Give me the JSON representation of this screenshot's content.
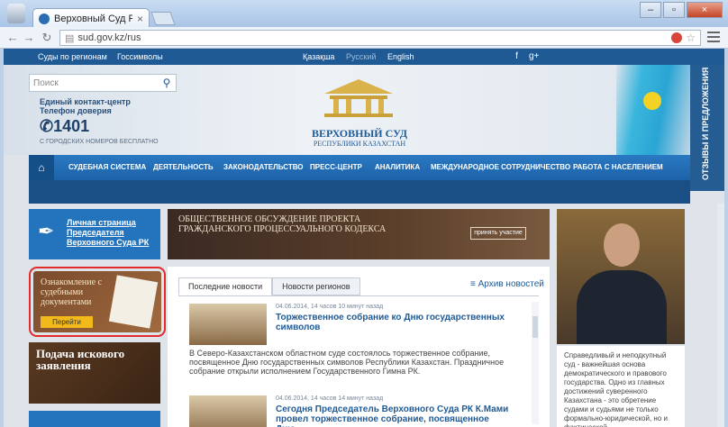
{
  "browser": {
    "tab_title": "Верховный Суд Республ",
    "tab_close": "×",
    "url": "sud.gov.kz/rus",
    "window_buttons": {
      "minimize": "–",
      "maximize": "▫",
      "close": "×"
    }
  },
  "topnav": {
    "regions": "Суды по регионам",
    "symbols": "Госсимволы",
    "lang_kz": "Қазақша",
    "lang_ru": "Русский",
    "lang_en": "English",
    "social": [
      "",
      "",
      "",
      "",
      "f",
      "g+",
      "",
      "",
      "",
      "",
      "",
      "",
      "",
      ""
    ]
  },
  "header": {
    "search_placeholder": "Поиск",
    "contact_line1": "Единый контакт-центр",
    "contact_line2": "Телефон доверия",
    "phone": "1401",
    "phone_note": "С ГОРОДСКИХ НОМЕРОВ БЕСПЛАТНО",
    "court_name_line1": "ВЕРХОВНЫЙ СУД",
    "court_name_line2": "РЕСПУБЛИКИ КАЗАХСТАН",
    "side_tab": "ОТЗЫВЫ И ПРЕДЛОЖЕНИЯ"
  },
  "mainnav": {
    "items": [
      "СУДЕБНАЯ СИСТЕМА",
      "ДЕЯТЕЛЬНОСТЬ",
      "ЗАКОНОДАТЕЛЬСТВО",
      "ПРЕСС-ЦЕНТР",
      "АНАЛИТИКА",
      "МЕЖДУНАРОДНОЕ СОТРУДНИЧЕСТВО",
      "РАБОТА С НАСЕЛЕНИЕМ"
    ]
  },
  "left": {
    "president_link": "Личная страница Председателя Верховного Суда РК",
    "docs_title": "Ознакомление с судебными документами",
    "docs_button": "Перейти",
    "claim_title": "Подача искового заявления"
  },
  "center": {
    "discussion_title": "ОБЩЕСТВЕННОЕ ОБСУЖДЕНИЕ ПРОЕКТА ГРАЖДАНСКОГО ПРОЦЕССУАЛЬНОГО КОДЕКСА",
    "discussion_button": "принять участие",
    "tab_latest": "Последние новости",
    "tab_regions": "Новости регионов",
    "archive": "Архив новостей",
    "news": [
      {
        "date": "04.06.2014, 14 часов 10 минут назад",
        "title": "Торжественное собрание ко Дню государственных символов",
        "desc": "В Северо-Казахстанском областном суде состоялось торжественное собрание, посвященное Дню государственных символов Республики Казахстан. Праздничное собрание открыли исполнением Государственного Гимна РК."
      },
      {
        "date": "04.06.2014, 14 часов 14 минут назад",
        "title": "Сегодня Председатель Верховного Суда РК К.Мами провел торжественное собрание, посвященное Дню"
      }
    ]
  },
  "right": {
    "quote": "Справедливый и неподкупный суд - важнейшая основа демократического и правового государства. Одно из главных достижений суверенного Казахстана - это обретение судами и судьями не только формально-юридической, но и фактической"
  }
}
